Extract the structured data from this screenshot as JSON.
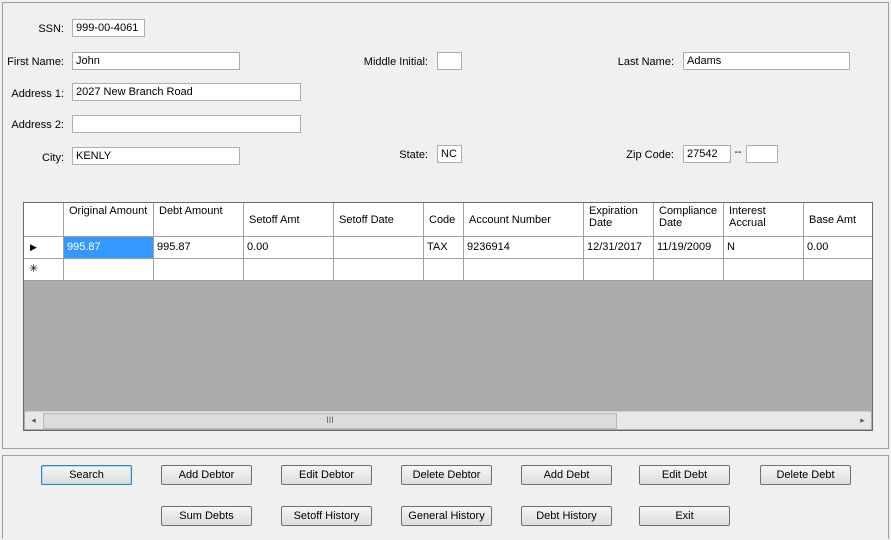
{
  "form": {
    "ssn_label": "SSN:",
    "ssn_value": "999-00-4061",
    "first_name_label": "First Name:",
    "first_name_value": "John",
    "middle_initial_label": "Middle Initial:",
    "middle_initial_value": "",
    "last_name_label": "Last Name:",
    "last_name_value": "Adams",
    "address1_label": "Address 1:",
    "address1_value": "2027 New Branch Road",
    "address2_label": "Address 2:",
    "address2_value": "",
    "city_label": "City:",
    "city_value": "KENLY",
    "state_label": "State:",
    "state_value": "NC",
    "zip_label": "Zip Code:",
    "zip_value": "27542",
    "zip_separator": "--",
    "zip_ext_value": ""
  },
  "grid": {
    "headers": [
      "Original Amount",
      "Debt Amount",
      "Setoff Amt",
      "Setoff Date",
      "Code",
      "Account Number",
      "Expiration Date",
      "Compliance Date",
      "Interest Accrual",
      "Base Amt"
    ],
    "rows": [
      [
        "995.87",
        "995.87",
        "0.00",
        "",
        "TAX",
        "9236914",
        "12/31/2017",
        "11/19/2009",
        "N",
        "0.00"
      ]
    ],
    "current_row_marker": "▶",
    "new_row_marker": "✳",
    "scroll_left": "◂",
    "scroll_right": "▸",
    "scroll_grip": "III"
  },
  "buttons": {
    "search": "Search",
    "add_debtor": "Add Debtor",
    "edit_debtor": "Edit Debtor",
    "delete_debtor": "Delete Debtor",
    "add_debt": "Add Debt",
    "edit_debt": "Edit Debt",
    "delete_debt": "Delete Debt",
    "sum_debts": "Sum Debts",
    "setoff_history": "Setoff History",
    "general_history": "General History",
    "debt_history": "Debt History",
    "exit": "Exit"
  }
}
